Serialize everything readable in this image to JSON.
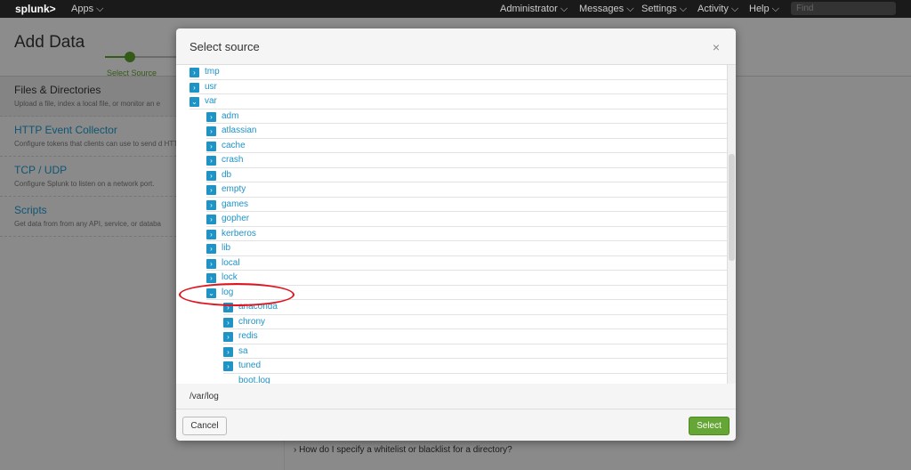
{
  "topbar": {
    "logo": "splunk>",
    "apps": "Apps ⌵",
    "nav": [
      {
        "label": "Administrator ⌵"
      },
      {
        "label": "Messages ⌵"
      },
      {
        "label": "Settings ⌵"
      },
      {
        "label": "Activity ⌵"
      },
      {
        "label": "Help ⌵"
      }
    ],
    "find_placeholder": "Find"
  },
  "page": {
    "title": "Add Data",
    "step": "Select Source",
    "sources": [
      {
        "title": "Files & Directories",
        "desc": "Upload a file, index a local file, or monitor an e"
      },
      {
        "title": "HTTP Event Collector",
        "desc": "Configure tokens that clients can use to send d HTTPS."
      },
      {
        "title": "TCP / UDP",
        "desc": "Configure Splunk to listen on a network port."
      },
      {
        "title": "Scripts",
        "desc": "Get data from from any API, service, or databa"
      }
    ],
    "faq": "How do I specify a whitelist or blacklist for a directory?"
  },
  "modal": {
    "title": "Select source",
    "close": "×",
    "tree": [
      {
        "label": "tmp",
        "level": 0,
        "state": "collapsed"
      },
      {
        "label": "usr",
        "level": 0,
        "state": "collapsed"
      },
      {
        "label": "var",
        "level": 0,
        "state": "expanded"
      },
      {
        "label": "adm",
        "level": 1,
        "state": "collapsed"
      },
      {
        "label": "atlassian",
        "level": 1,
        "state": "collapsed"
      },
      {
        "label": "cache",
        "level": 1,
        "state": "collapsed"
      },
      {
        "label": "crash",
        "level": 1,
        "state": "collapsed"
      },
      {
        "label": "db",
        "level": 1,
        "state": "collapsed"
      },
      {
        "label": "empty",
        "level": 1,
        "state": "collapsed"
      },
      {
        "label": "games",
        "level": 1,
        "state": "collapsed"
      },
      {
        "label": "gopher",
        "level": 1,
        "state": "collapsed"
      },
      {
        "label": "kerberos",
        "level": 1,
        "state": "collapsed"
      },
      {
        "label": "lib",
        "level": 1,
        "state": "collapsed"
      },
      {
        "label": "local",
        "level": 1,
        "state": "collapsed"
      },
      {
        "label": "lock",
        "level": 1,
        "state": "collapsed"
      },
      {
        "label": "log",
        "level": 1,
        "state": "expanded"
      },
      {
        "label": "anaconda",
        "level": 2,
        "state": "collapsed"
      },
      {
        "label": "chrony",
        "level": 2,
        "state": "collapsed"
      },
      {
        "label": "redis",
        "level": 2,
        "state": "collapsed"
      },
      {
        "label": "sa",
        "level": 2,
        "state": "collapsed"
      },
      {
        "label": "tuned",
        "level": 2,
        "state": "collapsed"
      },
      {
        "label": "boot.log",
        "level": 2,
        "state": "file"
      }
    ],
    "path": "/var/log",
    "cancel": "Cancel",
    "select": "Select"
  },
  "colors": {
    "accent": "#1e93c6",
    "primary_button": "#65a637",
    "highlight": "#e0141e"
  }
}
